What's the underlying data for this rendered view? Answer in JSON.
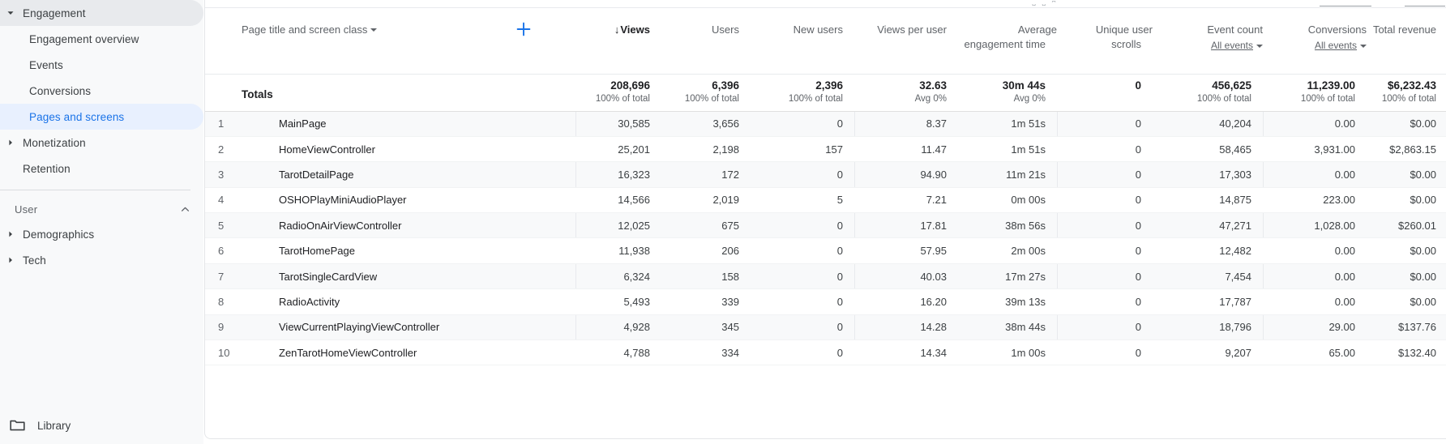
{
  "sidebar": {
    "groups": [
      {
        "name": "engagement-group",
        "header": {
          "label": "Engagement",
          "state": "expanded"
        },
        "children": [
          {
            "label": "Engagement overview",
            "selected": false
          },
          {
            "label": "Events",
            "selected": false
          },
          {
            "label": "Conversions",
            "selected": false
          },
          {
            "label": "Pages and screens",
            "selected": true
          }
        ]
      }
    ],
    "monetization": {
      "label": "Monetization"
    },
    "retention": {
      "label": "Retention"
    },
    "user_section": {
      "label": "User"
    },
    "demographics": {
      "label": "Demographics"
    },
    "tech": {
      "label": "Tech"
    },
    "library": {
      "label": "Library",
      "icon": "folder-icon"
    },
    "colors": {
      "background": "#f8f9fa",
      "selected_bg": "#e8f0fe",
      "selected_text": "#1a73e8",
      "expanded_bg": "#e8eaed"
    }
  },
  "table": {
    "dimension": {
      "label": "Page title and screen class",
      "icon": "chevron-down-icon"
    },
    "add_dimension": {
      "icon": "plus-icon",
      "label": "+"
    },
    "sort": {
      "column": "Views",
      "direction": "descending",
      "glyph": "↓"
    },
    "columns": [
      {
        "key": "rank",
        "label": ""
      },
      {
        "key": "dimension",
        "label": "Page title and screen class"
      },
      {
        "key": "views",
        "label": "Views",
        "sorted": true
      },
      {
        "key": "users",
        "label": "Users"
      },
      {
        "key": "new_users",
        "label": "New users"
      },
      {
        "key": "views_per_user",
        "label": "Views per user"
      },
      {
        "key": "avg_engagement_time",
        "label": "Average engagement time"
      },
      {
        "key": "unique_user_scrolls",
        "label": "Unique user scrolls"
      },
      {
        "key": "event_count",
        "label": "Event count",
        "selector": "All events"
      },
      {
        "key": "conversions",
        "label": "Conversions",
        "selector": "All events"
      },
      {
        "key": "total_revenue",
        "label": "Total revenue"
      }
    ],
    "totals": {
      "label": "Totals",
      "views": "208,696",
      "views_sub": "100% of total",
      "users": "6,396",
      "users_sub": "100% of total",
      "new_users": "2,396",
      "new_users_sub": "100% of total",
      "views_per_user": "32.63",
      "views_per_user_sub": "Avg 0%",
      "avg_engagement_time": "30m 44s",
      "avg_engagement_time_sub": "Avg 0%",
      "unique_user_scrolls": "0",
      "unique_user_scrolls_sub": "",
      "event_count": "456,625",
      "event_count_sub": "100% of total",
      "conversions": "11,239.00",
      "conversions_sub": "100% of total",
      "total_revenue": "$6,232.43",
      "total_revenue_sub": "100% of total"
    },
    "rows": [
      {
        "rank": "1",
        "dimension": "MainPage",
        "views": "30,585",
        "users": "3,656",
        "new_users": "0",
        "views_per_user": "8.37",
        "avg_engagement_time": "1m 51s",
        "unique_user_scrolls": "0",
        "event_count": "40,204",
        "conversions": "0.00",
        "total_revenue": "$0.00"
      },
      {
        "rank": "2",
        "dimension": "HomeViewController",
        "views": "25,201",
        "users": "2,198",
        "new_users": "157",
        "views_per_user": "11.47",
        "avg_engagement_time": "1m 51s",
        "unique_user_scrolls": "0",
        "event_count": "58,465",
        "conversions": "3,931.00",
        "total_revenue": "$2,863.15"
      },
      {
        "rank": "3",
        "dimension": "TarotDetailPage",
        "views": "16,323",
        "users": "172",
        "new_users": "0",
        "views_per_user": "94.90",
        "avg_engagement_time": "11m 21s",
        "unique_user_scrolls": "0",
        "event_count": "17,303",
        "conversions": "0.00",
        "total_revenue": "$0.00"
      },
      {
        "rank": "4",
        "dimension": "OSHOPlayMiniAudioPlayer",
        "views": "14,566",
        "users": "2,019",
        "new_users": "5",
        "views_per_user": "7.21",
        "avg_engagement_time": "0m 00s",
        "unique_user_scrolls": "0",
        "event_count": "14,875",
        "conversions": "223.00",
        "total_revenue": "$0.00"
      },
      {
        "rank": "5",
        "dimension": "RadioOnAirViewController",
        "views": "12,025",
        "users": "675",
        "new_users": "0",
        "views_per_user": "17.81",
        "avg_engagement_time": "38m 56s",
        "unique_user_scrolls": "0",
        "event_count": "47,271",
        "conversions": "1,028.00",
        "total_revenue": "$260.01"
      },
      {
        "rank": "6",
        "dimension": "TarotHomePage",
        "views": "11,938",
        "users": "206",
        "new_users": "0",
        "views_per_user": "57.95",
        "avg_engagement_time": "2m 00s",
        "unique_user_scrolls": "0",
        "event_count": "12,482",
        "conversions": "0.00",
        "total_revenue": "$0.00"
      },
      {
        "rank": "7",
        "dimension": "TarotSingleCardView",
        "views": "6,324",
        "users": "158",
        "new_users": "0",
        "views_per_user": "40.03",
        "avg_engagement_time": "17m 27s",
        "unique_user_scrolls": "0",
        "event_count": "7,454",
        "conversions": "0.00",
        "total_revenue": "$0.00"
      },
      {
        "rank": "8",
        "dimension": "RadioActivity",
        "views": "5,493",
        "users": "339",
        "new_users": "0",
        "views_per_user": "16.20",
        "avg_engagement_time": "39m 13s",
        "unique_user_scrolls": "0",
        "event_count": "17,787",
        "conversions": "0.00",
        "total_revenue": "$0.00"
      },
      {
        "rank": "9",
        "dimension": "ViewCurrentPlayingViewController",
        "views": "4,928",
        "users": "345",
        "new_users": "0",
        "views_per_user": "14.28",
        "avg_engagement_time": "38m 44s",
        "unique_user_scrolls": "0",
        "event_count": "18,796",
        "conversions": "29.00",
        "total_revenue": "$137.76"
      },
      {
        "rank": "10",
        "dimension": "ZenTarotHomeViewController",
        "views": "4,788",
        "users": "334",
        "new_users": "0",
        "views_per_user": "14.34",
        "avg_engagement_time": "1m 00s",
        "unique_user_scrolls": "0",
        "event_count": "9,207",
        "conversions": "65.00",
        "total_revenue": "$132.40"
      }
    ]
  },
  "colors": {
    "accent": "#1a73e8",
    "text_primary": "#202124",
    "text_secondary": "#5f6368",
    "stripe": "#f8f9fa",
    "border": "#e8eaed"
  }
}
